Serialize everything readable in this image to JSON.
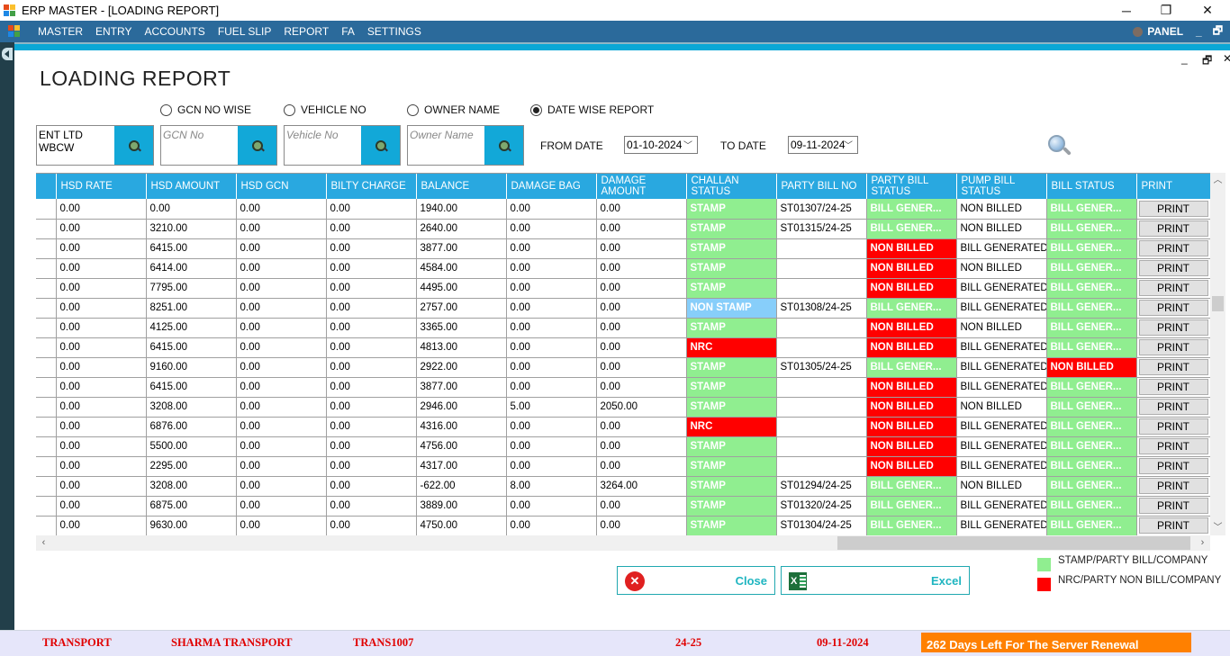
{
  "window": {
    "title": "ERP MASTER - [LOADING REPORT]",
    "controls": {
      "minimize": "─",
      "restore": "❐",
      "close": "✕"
    }
  },
  "menubar": {
    "items": [
      "MASTER",
      "ENTRY",
      "ACCOUNTS",
      "FUEL SLIP",
      "REPORT",
      "FA",
      "SETTINGS"
    ],
    "panel_label": "PANEL",
    "child_controls": {
      "minimize": "_",
      "restore": "🗗"
    }
  },
  "child_window": {
    "controls": {
      "minimize": "_",
      "restore": "🗗",
      "close": "✕"
    }
  },
  "page": {
    "title": "LOADING REPORT"
  },
  "filters": {
    "radios": [
      {
        "label": "GCN NO WISE",
        "checked": false
      },
      {
        "label": "VEHICLE NO",
        "checked": false
      },
      {
        "label": "OWNER NAME",
        "checked": false
      },
      {
        "label": "DATE WISE REPORT",
        "checked": true
      }
    ],
    "party_value": "ENT LTD WBCW",
    "gcn_placeholder": "GCN No",
    "vehicle_placeholder": "Vehicle No",
    "owner_placeholder": "Owner Name",
    "from_date_label": "FROM DATE",
    "from_date": "01-10-2024",
    "to_date_label": "TO DATE",
    "to_date": "09-11-2024"
  },
  "grid": {
    "columns": [
      "HSD RATE",
      "HSD AMOUNT",
      "HSD GCN",
      "BILTY CHARGE",
      "BALANCE",
      "DAMAGE BAG",
      "DAMAGE AMOUNT",
      "CHALLAN STATUS",
      "PARTY BILL NO",
      "PARTY BILL STATUS",
      "PUMP BILL STATUS",
      "BILL STATUS",
      "PRINT"
    ],
    "status_colors": {
      "green": "#90ee90",
      "red": "#ff0000",
      "blue": "#87cefa"
    },
    "rows": [
      {
        "hsd_rate": "0.00",
        "hsd_amount": "0.00",
        "hsd_gcn": "0.00",
        "bilty": "0.00",
        "balance": "1940.00",
        "dmg_bag": "0.00",
        "dmg_amt": "0.00",
        "challan": "STAMP",
        "challan_c": "green",
        "party_no": "ST01307/24-25",
        "party_status": "BILL GENER...",
        "party_c": "green",
        "pump": "NON BILLED",
        "bill": "BILL GENER...",
        "bill_c": "green",
        "print": "PRINT"
      },
      {
        "hsd_rate": "0.00",
        "hsd_amount": "3210.00",
        "hsd_gcn": "0.00",
        "bilty": "0.00",
        "balance": "2640.00",
        "dmg_bag": "0.00",
        "dmg_amt": "0.00",
        "challan": "STAMP",
        "challan_c": "green",
        "party_no": "ST01315/24-25",
        "party_status": "BILL GENER...",
        "party_c": "green",
        "pump": "NON BILLED",
        "bill": "BILL GENER...",
        "bill_c": "green",
        "print": "PRINT"
      },
      {
        "hsd_rate": "0.00",
        "hsd_amount": "6415.00",
        "hsd_gcn": "0.00",
        "bilty": "0.00",
        "balance": "3877.00",
        "dmg_bag": "0.00",
        "dmg_amt": "0.00",
        "challan": "STAMP",
        "challan_c": "green",
        "party_no": "",
        "party_status": "NON BILLED",
        "party_c": "red",
        "pump": "BILL GENERATED",
        "bill": "BILL GENER...",
        "bill_c": "green",
        "print": "PRINT"
      },
      {
        "hsd_rate": "0.00",
        "hsd_amount": "6414.00",
        "hsd_gcn": "0.00",
        "bilty": "0.00",
        "balance": "4584.00",
        "dmg_bag": "0.00",
        "dmg_amt": "0.00",
        "challan": "STAMP",
        "challan_c": "green",
        "party_no": "",
        "party_status": "NON BILLED",
        "party_c": "red",
        "pump": "NON BILLED",
        "bill": "BILL GENER...",
        "bill_c": "green",
        "print": "PRINT"
      },
      {
        "hsd_rate": "0.00",
        "hsd_amount": "7795.00",
        "hsd_gcn": "0.00",
        "bilty": "0.00",
        "balance": "4495.00",
        "dmg_bag": "0.00",
        "dmg_amt": "0.00",
        "challan": "STAMP",
        "challan_c": "green",
        "party_no": "",
        "party_status": "NON BILLED",
        "party_c": "red",
        "pump": "BILL GENERATED",
        "bill": "BILL GENER...",
        "bill_c": "green",
        "print": "PRINT"
      },
      {
        "hsd_rate": "0.00",
        "hsd_amount": "8251.00",
        "hsd_gcn": "0.00",
        "bilty": "0.00",
        "balance": "2757.00",
        "dmg_bag": "0.00",
        "dmg_amt": "0.00",
        "challan": "NON STAMP",
        "challan_c": "blue",
        "party_no": "ST01308/24-25",
        "party_status": "BILL GENER...",
        "party_c": "green",
        "pump": "BILL GENERATED",
        "bill": "BILL GENER...",
        "bill_c": "green",
        "print": "PRINT"
      },
      {
        "hsd_rate": "0.00",
        "hsd_amount": "4125.00",
        "hsd_gcn": "0.00",
        "bilty": "0.00",
        "balance": "3365.00",
        "dmg_bag": "0.00",
        "dmg_amt": "0.00",
        "challan": "STAMP",
        "challan_c": "green",
        "party_no": "",
        "party_status": "NON BILLED",
        "party_c": "red",
        "pump": "NON BILLED",
        "bill": "BILL GENER...",
        "bill_c": "green",
        "print": "PRINT"
      },
      {
        "hsd_rate": "0.00",
        "hsd_amount": "6415.00",
        "hsd_gcn": "0.00",
        "bilty": "0.00",
        "balance": "4813.00",
        "dmg_bag": "0.00",
        "dmg_amt": "0.00",
        "challan": "NRC",
        "challan_c": "red",
        "party_no": "",
        "party_status": "NON BILLED",
        "party_c": "red",
        "pump": "BILL GENERATED",
        "bill": "BILL GENER...",
        "bill_c": "green",
        "print": "PRINT"
      },
      {
        "hsd_rate": "0.00",
        "hsd_amount": "9160.00",
        "hsd_gcn": "0.00",
        "bilty": "0.00",
        "balance": "2922.00",
        "dmg_bag": "0.00",
        "dmg_amt": "0.00",
        "challan": "STAMP",
        "challan_c": "green",
        "party_no": "ST01305/24-25",
        "party_status": "BILL GENER...",
        "party_c": "green",
        "pump": "BILL GENERATED",
        "bill": "NON BILLED",
        "bill_c": "red",
        "print": "PRINT"
      },
      {
        "hsd_rate": "0.00",
        "hsd_amount": "6415.00",
        "hsd_gcn": "0.00",
        "bilty": "0.00",
        "balance": "3877.00",
        "dmg_bag": "0.00",
        "dmg_amt": "0.00",
        "challan": "STAMP",
        "challan_c": "green",
        "party_no": "",
        "party_status": "NON BILLED",
        "party_c": "red",
        "pump": "BILL GENERATED",
        "bill": "BILL GENER...",
        "bill_c": "green",
        "print": "PRINT"
      },
      {
        "hsd_rate": "0.00",
        "hsd_amount": "3208.00",
        "hsd_gcn": "0.00",
        "bilty": "0.00",
        "balance": "2946.00",
        "dmg_bag": "5.00",
        "dmg_amt": "2050.00",
        "challan": "STAMP",
        "challan_c": "green",
        "party_no": "",
        "party_status": "NON BILLED",
        "party_c": "red",
        "pump": "NON BILLED",
        "bill": "BILL GENER...",
        "bill_c": "green",
        "print": "PRINT"
      },
      {
        "hsd_rate": "0.00",
        "hsd_amount": "6876.00",
        "hsd_gcn": "0.00",
        "bilty": "0.00",
        "balance": "4316.00",
        "dmg_bag": "0.00",
        "dmg_amt": "0.00",
        "challan": "NRC",
        "challan_c": "red",
        "party_no": "",
        "party_status": "NON BILLED",
        "party_c": "red",
        "pump": "BILL GENERATED",
        "bill": "BILL GENER...",
        "bill_c": "green",
        "print": "PRINT"
      },
      {
        "hsd_rate": "0.00",
        "hsd_amount": "5500.00",
        "hsd_gcn": "0.00",
        "bilty": "0.00",
        "balance": "4756.00",
        "dmg_bag": "0.00",
        "dmg_amt": "0.00",
        "challan": "STAMP",
        "challan_c": "green",
        "party_no": "",
        "party_status": "NON BILLED",
        "party_c": "red",
        "pump": "BILL GENERATED",
        "bill": "BILL GENER...",
        "bill_c": "green",
        "print": "PRINT"
      },
      {
        "hsd_rate": "0.00",
        "hsd_amount": "2295.00",
        "hsd_gcn": "0.00",
        "bilty": "0.00",
        "balance": "4317.00",
        "dmg_bag": "0.00",
        "dmg_amt": "0.00",
        "challan": "STAMP",
        "challan_c": "green",
        "party_no": "",
        "party_status": "NON BILLED",
        "party_c": "red",
        "pump": "BILL GENERATED",
        "bill": "BILL GENER...",
        "bill_c": "green",
        "print": "PRINT"
      },
      {
        "hsd_rate": "0.00",
        "hsd_amount": "3208.00",
        "hsd_gcn": "0.00",
        "bilty": "0.00",
        "balance": "-622.00",
        "dmg_bag": "8.00",
        "dmg_amt": "3264.00",
        "challan": "STAMP",
        "challan_c": "green",
        "party_no": "ST01294/24-25",
        "party_status": "BILL GENER...",
        "party_c": "green",
        "pump": "NON BILLED",
        "bill": "BILL GENER...",
        "bill_c": "green",
        "print": "PRINT"
      },
      {
        "hsd_rate": "0.00",
        "hsd_amount": "6875.00",
        "hsd_gcn": "0.00",
        "bilty": "0.00",
        "balance": "3889.00",
        "dmg_bag": "0.00",
        "dmg_amt": "0.00",
        "challan": "STAMP",
        "challan_c": "green",
        "party_no": "ST01320/24-25",
        "party_status": "BILL GENER...",
        "party_c": "green",
        "pump": "BILL GENERATED",
        "bill": "BILL GENER...",
        "bill_c": "green",
        "print": "PRINT"
      },
      {
        "hsd_rate": "0.00",
        "hsd_amount": "9630.00",
        "hsd_gcn": "0.00",
        "bilty": "0.00",
        "balance": "4750.00",
        "dmg_bag": "0.00",
        "dmg_amt": "0.00",
        "challan": "STAMP",
        "challan_c": "green",
        "party_no": "ST01304/24-25",
        "party_status": "BILL GENER...",
        "party_c": "green",
        "pump": "BILL GENERATED",
        "bill": "BILL GENER...",
        "bill_c": "green",
        "print": "PRINT"
      }
    ]
  },
  "actions": {
    "close_label": "Close",
    "excel_label": "Excel"
  },
  "legend": [
    {
      "label": "STAMP/PARTY BILL/COMPANY",
      "color": "#90ee90"
    },
    {
      "label": "NRC/PARTY NON BILL/COMPANY",
      "color": "#ff0000"
    }
  ],
  "statusbar": {
    "module": "TRANSPORT",
    "company": "SHARMA TRANSPORT",
    "code": "TRANS1007",
    "fin_year": "24-25",
    "date": "09-11-2024",
    "renewal": "262 Days Left For The Server Renewal"
  }
}
